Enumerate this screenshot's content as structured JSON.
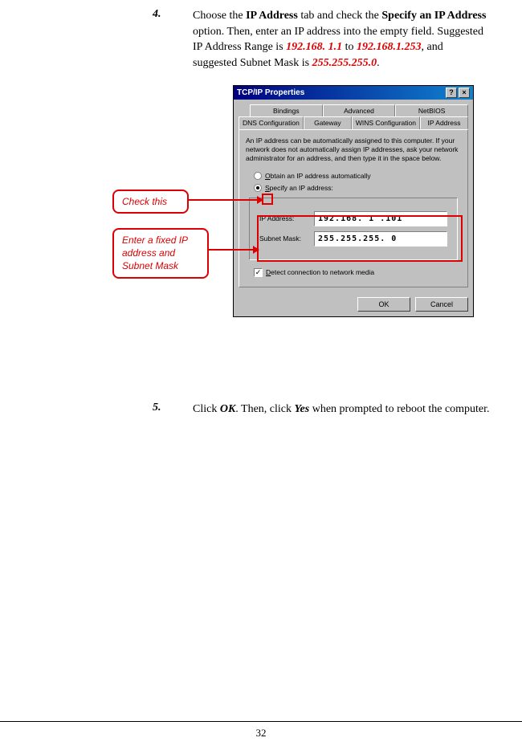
{
  "step4": {
    "num": "4.",
    "t1": "Choose the ",
    "b1": "IP Address",
    "t2": " tab and check the ",
    "b2": "Specify an IP Address",
    "t3": " option.  Then, enter an IP address into the empty field.  Suggested IP Address Range is ",
    "r1": "192.168. 1.1",
    "t4": " to ",
    "r2": "192.168.1.253",
    "t5": ", and suggested Subnet Mask is ",
    "r3": "255.255.255.0",
    "t6": "."
  },
  "dialog": {
    "title": "TCP/IP Properties",
    "help": "?",
    "close": "×",
    "tabs_back": {
      "bindings": "Bindings",
      "advanced": "Advanced",
      "netbios": "NetBIOS"
    },
    "tabs_front": {
      "dns": "DNS Configuration",
      "gateway": "Gateway",
      "wins": "WINS Configuration",
      "ip": "IP Address"
    },
    "desc": "An IP address can be automatically assigned to this computer. If your network does not automatically assign IP addresses, ask your network administrator for an address, and then type it in the space below.",
    "radio_auto_u": "O",
    "radio_auto": "btain an IP address automatically",
    "radio_spec_u": "S",
    "radio_spec": "pecify an IP address:",
    "ip_label": "IP Address:",
    "ip_value": "192.168. 1 .101",
    "mask_label": "Subnet Mask:",
    "mask_value": "255.255.255. 0",
    "detect_u": "D",
    "detect": "etect connection to network media",
    "ok": "OK",
    "cancel": "Cancel"
  },
  "callouts": {
    "c1": "Check this",
    "c2": "Enter a fixed IP address and Subnet Mask"
  },
  "step5": {
    "num": "5.",
    "t1": "Click ",
    "b1": "OK",
    "t2": ".  Then, click ",
    "b2": "Yes",
    "t3": " when prompted to reboot the computer."
  },
  "page_number": "32"
}
